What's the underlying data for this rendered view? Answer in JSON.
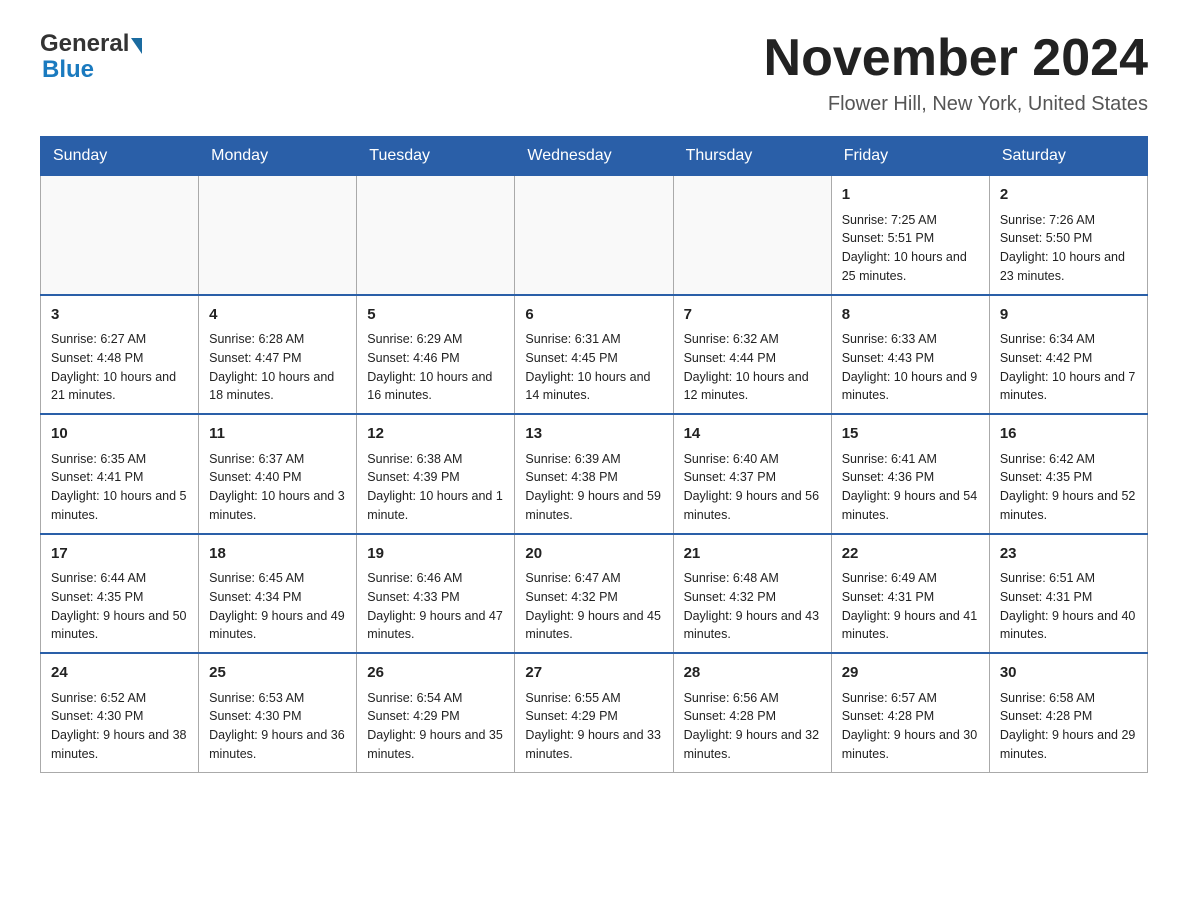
{
  "header": {
    "logo_general": "General",
    "logo_blue": "Blue",
    "month_title": "November 2024",
    "location": "Flower Hill, New York, United States"
  },
  "weekdays": [
    "Sunday",
    "Monday",
    "Tuesday",
    "Wednesday",
    "Thursday",
    "Friday",
    "Saturday"
  ],
  "weeks": [
    [
      {
        "day": "",
        "sunrise": "",
        "sunset": "",
        "daylight": ""
      },
      {
        "day": "",
        "sunrise": "",
        "sunset": "",
        "daylight": ""
      },
      {
        "day": "",
        "sunrise": "",
        "sunset": "",
        "daylight": ""
      },
      {
        "day": "",
        "sunrise": "",
        "sunset": "",
        "daylight": ""
      },
      {
        "day": "",
        "sunrise": "",
        "sunset": "",
        "daylight": ""
      },
      {
        "day": "1",
        "sunrise": "Sunrise: 7:25 AM",
        "sunset": "Sunset: 5:51 PM",
        "daylight": "Daylight: 10 hours and 25 minutes."
      },
      {
        "day": "2",
        "sunrise": "Sunrise: 7:26 AM",
        "sunset": "Sunset: 5:50 PM",
        "daylight": "Daylight: 10 hours and 23 minutes."
      }
    ],
    [
      {
        "day": "3",
        "sunrise": "Sunrise: 6:27 AM",
        "sunset": "Sunset: 4:48 PM",
        "daylight": "Daylight: 10 hours and 21 minutes."
      },
      {
        "day": "4",
        "sunrise": "Sunrise: 6:28 AM",
        "sunset": "Sunset: 4:47 PM",
        "daylight": "Daylight: 10 hours and 18 minutes."
      },
      {
        "day": "5",
        "sunrise": "Sunrise: 6:29 AM",
        "sunset": "Sunset: 4:46 PM",
        "daylight": "Daylight: 10 hours and 16 minutes."
      },
      {
        "day": "6",
        "sunrise": "Sunrise: 6:31 AM",
        "sunset": "Sunset: 4:45 PM",
        "daylight": "Daylight: 10 hours and 14 minutes."
      },
      {
        "day": "7",
        "sunrise": "Sunrise: 6:32 AM",
        "sunset": "Sunset: 4:44 PM",
        "daylight": "Daylight: 10 hours and 12 minutes."
      },
      {
        "day": "8",
        "sunrise": "Sunrise: 6:33 AM",
        "sunset": "Sunset: 4:43 PM",
        "daylight": "Daylight: 10 hours and 9 minutes."
      },
      {
        "day": "9",
        "sunrise": "Sunrise: 6:34 AM",
        "sunset": "Sunset: 4:42 PM",
        "daylight": "Daylight: 10 hours and 7 minutes."
      }
    ],
    [
      {
        "day": "10",
        "sunrise": "Sunrise: 6:35 AM",
        "sunset": "Sunset: 4:41 PM",
        "daylight": "Daylight: 10 hours and 5 minutes."
      },
      {
        "day": "11",
        "sunrise": "Sunrise: 6:37 AM",
        "sunset": "Sunset: 4:40 PM",
        "daylight": "Daylight: 10 hours and 3 minutes."
      },
      {
        "day": "12",
        "sunrise": "Sunrise: 6:38 AM",
        "sunset": "Sunset: 4:39 PM",
        "daylight": "Daylight: 10 hours and 1 minute."
      },
      {
        "day": "13",
        "sunrise": "Sunrise: 6:39 AM",
        "sunset": "Sunset: 4:38 PM",
        "daylight": "Daylight: 9 hours and 59 minutes."
      },
      {
        "day": "14",
        "sunrise": "Sunrise: 6:40 AM",
        "sunset": "Sunset: 4:37 PM",
        "daylight": "Daylight: 9 hours and 56 minutes."
      },
      {
        "day": "15",
        "sunrise": "Sunrise: 6:41 AM",
        "sunset": "Sunset: 4:36 PM",
        "daylight": "Daylight: 9 hours and 54 minutes."
      },
      {
        "day": "16",
        "sunrise": "Sunrise: 6:42 AM",
        "sunset": "Sunset: 4:35 PM",
        "daylight": "Daylight: 9 hours and 52 minutes."
      }
    ],
    [
      {
        "day": "17",
        "sunrise": "Sunrise: 6:44 AM",
        "sunset": "Sunset: 4:35 PM",
        "daylight": "Daylight: 9 hours and 50 minutes."
      },
      {
        "day": "18",
        "sunrise": "Sunrise: 6:45 AM",
        "sunset": "Sunset: 4:34 PM",
        "daylight": "Daylight: 9 hours and 49 minutes."
      },
      {
        "day": "19",
        "sunrise": "Sunrise: 6:46 AM",
        "sunset": "Sunset: 4:33 PM",
        "daylight": "Daylight: 9 hours and 47 minutes."
      },
      {
        "day": "20",
        "sunrise": "Sunrise: 6:47 AM",
        "sunset": "Sunset: 4:32 PM",
        "daylight": "Daylight: 9 hours and 45 minutes."
      },
      {
        "day": "21",
        "sunrise": "Sunrise: 6:48 AM",
        "sunset": "Sunset: 4:32 PM",
        "daylight": "Daylight: 9 hours and 43 minutes."
      },
      {
        "day": "22",
        "sunrise": "Sunrise: 6:49 AM",
        "sunset": "Sunset: 4:31 PM",
        "daylight": "Daylight: 9 hours and 41 minutes."
      },
      {
        "day": "23",
        "sunrise": "Sunrise: 6:51 AM",
        "sunset": "Sunset: 4:31 PM",
        "daylight": "Daylight: 9 hours and 40 minutes."
      }
    ],
    [
      {
        "day": "24",
        "sunrise": "Sunrise: 6:52 AM",
        "sunset": "Sunset: 4:30 PM",
        "daylight": "Daylight: 9 hours and 38 minutes."
      },
      {
        "day": "25",
        "sunrise": "Sunrise: 6:53 AM",
        "sunset": "Sunset: 4:30 PM",
        "daylight": "Daylight: 9 hours and 36 minutes."
      },
      {
        "day": "26",
        "sunrise": "Sunrise: 6:54 AM",
        "sunset": "Sunset: 4:29 PM",
        "daylight": "Daylight: 9 hours and 35 minutes."
      },
      {
        "day": "27",
        "sunrise": "Sunrise: 6:55 AM",
        "sunset": "Sunset: 4:29 PM",
        "daylight": "Daylight: 9 hours and 33 minutes."
      },
      {
        "day": "28",
        "sunrise": "Sunrise: 6:56 AM",
        "sunset": "Sunset: 4:28 PM",
        "daylight": "Daylight: 9 hours and 32 minutes."
      },
      {
        "day": "29",
        "sunrise": "Sunrise: 6:57 AM",
        "sunset": "Sunset: 4:28 PM",
        "daylight": "Daylight: 9 hours and 30 minutes."
      },
      {
        "day": "30",
        "sunrise": "Sunrise: 6:58 AM",
        "sunset": "Sunset: 4:28 PM",
        "daylight": "Daylight: 9 hours and 29 minutes."
      }
    ]
  ]
}
